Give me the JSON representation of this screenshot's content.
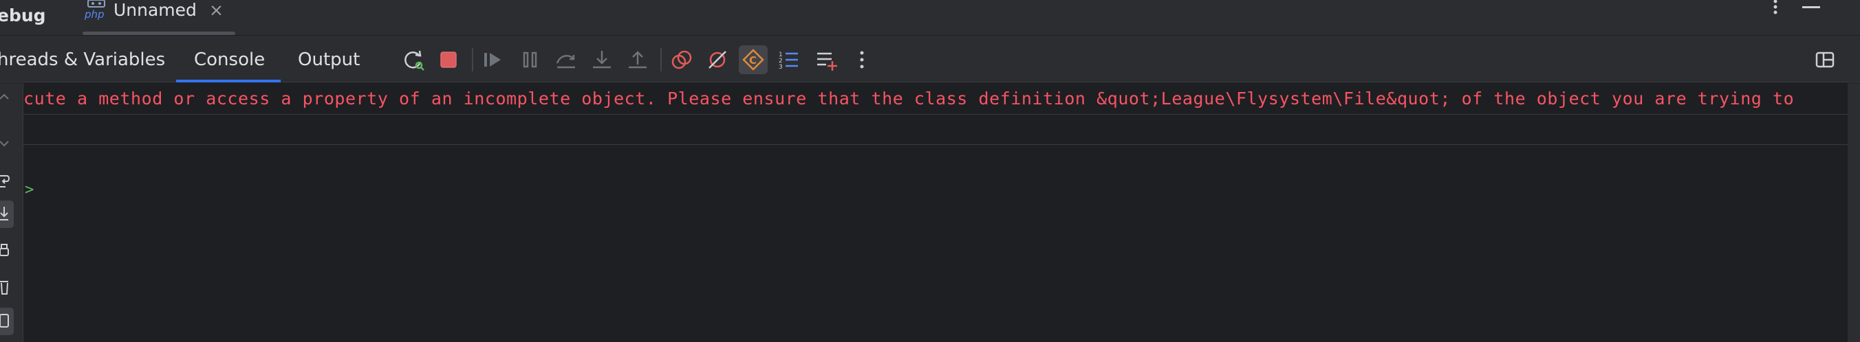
{
  "window": {
    "title": "ebug",
    "tab": {
      "label": "Unnamed",
      "icon": "php-icon",
      "close": "×"
    }
  },
  "toolbar": {
    "tabs": [
      {
        "label": "hreads & Variables"
      },
      {
        "label": "Console",
        "selected": true
      },
      {
        "label": "Output"
      }
    ],
    "icons": [
      "rerun-icon",
      "stop-icon",
      "resume-icon",
      "pause-icon",
      "step-over-icon",
      "step-into-icon",
      "step-out-icon",
      "view-breakpoints-icon",
      "mute-breakpoints-icon",
      "listen-debug-icon",
      "frames-list-icon",
      "add-watch-icon",
      "more-icon"
    ],
    "layout_icon": "layout-icon"
  },
  "gutter": {
    "icons": [
      "scroll-up-icon",
      "scroll-down-icon",
      "soft-wrap-icon",
      "scroll-to-end-icon",
      "print-icon",
      "clear-icon",
      "console-settings-icon"
    ]
  },
  "console": {
    "error_line": "cute a method or access a property of an incomplete object. Please ensure that the class definition &quot;League\\Flysystem\\File&quot; of the object you are trying to",
    "prompt": ">"
  },
  "colors": {
    "background": "#1e1f22",
    "panel": "#2b2d30",
    "error": "#f75464",
    "accent": "#3574f0",
    "prompt": "#5fb95c"
  }
}
